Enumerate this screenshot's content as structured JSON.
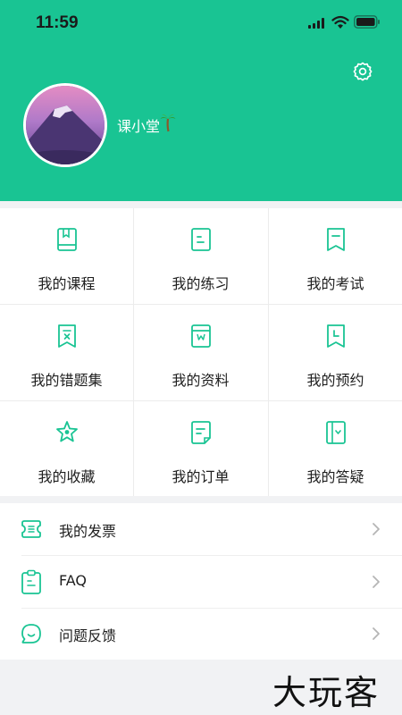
{
  "status_bar": {
    "time": "11:59"
  },
  "profile": {
    "username": "课小堂"
  },
  "menu_grid": [
    {
      "label": "我的课程",
      "icon": "book-icon"
    },
    {
      "label": "我的练习",
      "icon": "document-icon"
    },
    {
      "label": "我的考试",
      "icon": "bookmark-icon"
    },
    {
      "label": "我的错题集",
      "icon": "wrong-bookmark-icon"
    },
    {
      "label": "我的资料",
      "icon": "materials-icon"
    },
    {
      "label": "我的预约",
      "icon": "clock-bookmark-icon"
    },
    {
      "label": "我的收藏",
      "icon": "star-icon"
    },
    {
      "label": "我的订单",
      "icon": "order-icon"
    },
    {
      "label": "我的答疑",
      "icon": "qa-book-icon"
    }
  ],
  "list": [
    {
      "label": "我的发票",
      "icon": "invoice-icon"
    },
    {
      "label": "FAQ",
      "icon": "clipboard-icon"
    },
    {
      "label": "问题反馈",
      "icon": "feedback-icon"
    }
  ],
  "watermark": "大玩客",
  "colors": {
    "brand": "#19c493",
    "background": "#f1f2f4"
  }
}
